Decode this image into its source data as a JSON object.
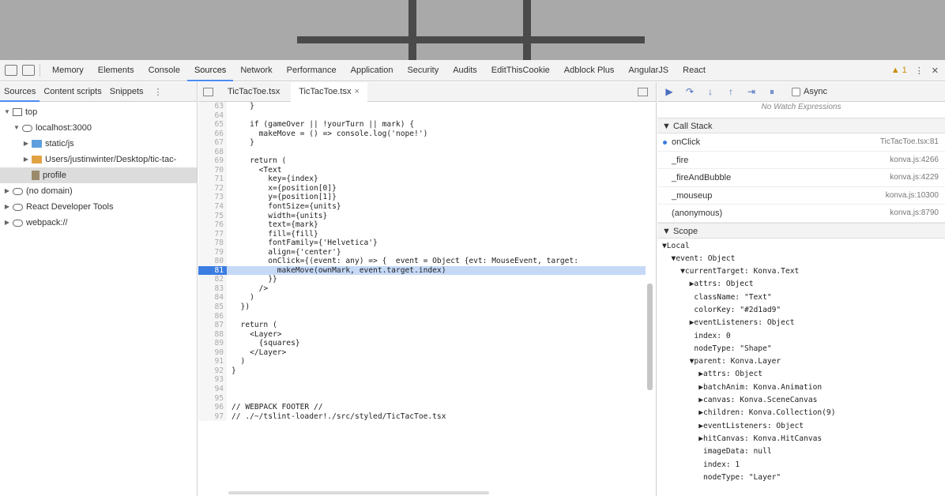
{
  "toolbar": {
    "tabs": [
      "Memory",
      "Elements",
      "Console",
      "Sources",
      "Network",
      "Performance",
      "Application",
      "Security",
      "Audits",
      "EditThisCookie",
      "Adblock Plus",
      "AngularJS",
      "React"
    ],
    "warnings": "▲ 1",
    "menu": "⋮"
  },
  "navigator": {
    "tabs": [
      "Sources",
      "Content scripts",
      "Snippets"
    ],
    "tree": [
      {
        "label": "top",
        "indent": 0,
        "icon": "frame",
        "tri": "▼"
      },
      {
        "label": "localhost:3000",
        "indent": 1,
        "icon": "cloud",
        "tri": "▼"
      },
      {
        "label": "static/js",
        "indent": 2,
        "icon": "folder-blue",
        "tri": "▶"
      },
      {
        "label": "Users/justinwinter/Desktop/tic-tac-",
        "indent": 2,
        "icon": "folder-orange",
        "tri": "▶"
      },
      {
        "label": "profile",
        "indent": 2,
        "icon": "file",
        "tri": "",
        "selected": true
      },
      {
        "label": "(no domain)",
        "indent": 0,
        "icon": "cloud",
        "tri": "▶"
      },
      {
        "label": "React Developer Tools",
        "indent": 0,
        "icon": "cloud",
        "tri": "▶"
      },
      {
        "label": "webpack://",
        "indent": 0,
        "icon": "cloud",
        "tri": "▶"
      }
    ]
  },
  "editor": {
    "tabs": [
      {
        "label": "TicTacToe.tsx",
        "active": false,
        "close": ""
      },
      {
        "label": "TicTacToe.tsx",
        "active": true,
        "close": "×"
      }
    ],
    "lines": [
      {
        "n": "63",
        "t": "    }"
      },
      {
        "n": "64",
        "t": ""
      },
      {
        "n": "65",
        "t": "    if (gameOver || !yourTurn || mark) {"
      },
      {
        "n": "66",
        "t": "      makeMove = () => console.log('nope!')"
      },
      {
        "n": "67",
        "t": "    }"
      },
      {
        "n": "68",
        "t": ""
      },
      {
        "n": "69",
        "t": "    return ("
      },
      {
        "n": "70",
        "t": "      <Text"
      },
      {
        "n": "71",
        "t": "        key={index}"
      },
      {
        "n": "72",
        "t": "        x={position[0]}"
      },
      {
        "n": "73",
        "t": "        y={position[1]}"
      },
      {
        "n": "74",
        "t": "        fontSize={units}"
      },
      {
        "n": "75",
        "t": "        width={units}"
      },
      {
        "n": "76",
        "t": "        text={mark}"
      },
      {
        "n": "77",
        "t": "        fill={fill}"
      },
      {
        "n": "78",
        "t": "        fontFamily={'Helvetica'}"
      },
      {
        "n": "79",
        "t": "        align={'center'}"
      },
      {
        "n": "80",
        "t": "        onClick={(event: any) => {  event = Object {evt: MouseEvent, target:"
      },
      {
        "n": "81",
        "t": "          makeMove(ownMark, event.target.index)",
        "exec": true
      },
      {
        "n": "82",
        "t": "        }}"
      },
      {
        "n": "83",
        "t": "      />"
      },
      {
        "n": "84",
        "t": "    )"
      },
      {
        "n": "85",
        "t": "  })"
      },
      {
        "n": "86",
        "t": ""
      },
      {
        "n": "87",
        "t": "  return ("
      },
      {
        "n": "88",
        "t": "    <Layer>"
      },
      {
        "n": "89",
        "t": "      {squares}"
      },
      {
        "n": "90",
        "t": "    </Layer>"
      },
      {
        "n": "91",
        "t": "  )"
      },
      {
        "n": "92",
        "t": "}"
      },
      {
        "n": "93",
        "t": ""
      },
      {
        "n": "94",
        "t": ""
      },
      {
        "n": "95",
        "t": ""
      },
      {
        "n": "96",
        "t": "// WEBPACK FOOTER //"
      },
      {
        "n": "97",
        "t": "// ./~/tslint-loader!./src/styled/TicTacToe.tsx"
      }
    ]
  },
  "debugger": {
    "async_label": "Async",
    "no_watch": "No Watch Expressions",
    "call_stack_label": "▼ Call Stack",
    "frames": [
      {
        "fn": "onClick",
        "loc": "TicTacToe.tsx:81",
        "current": true
      },
      {
        "fn": "_fire",
        "loc": "konva.js:4266",
        "current": false
      },
      {
        "fn": "_fireAndBubble",
        "loc": "konva.js:4229",
        "current": false
      },
      {
        "fn": "_mouseup",
        "loc": "konva.js:10300",
        "current": false
      },
      {
        "fn": "(anonymous)",
        "loc": "konva.js:8790",
        "current": false
      }
    ],
    "scope_label": "▼ Scope",
    "scope": [
      "▼Local",
      "  ▼event: Object",
      "    ▼currentTarget: Konva.Text",
      "      ▶attrs: Object",
      "       className: \"Text\"",
      "       colorKey: \"#2d1ad9\"",
      "      ▶eventListeners: Object",
      "       index: 0",
      "       nodeType: \"Shape\"",
      "      ▼parent: Konva.Layer",
      "        ▶attrs: Object",
      "        ▶batchAnim: Konva.Animation",
      "        ▶canvas: Konva.SceneCanvas",
      "        ▶children: Konva.Collection(9)",
      "        ▶eventListeners: Object",
      "        ▶hitCanvas: Konva.HitCanvas",
      "         imageData: null",
      "         index: 1",
      "         nodeType: \"Layer\""
    ]
  }
}
